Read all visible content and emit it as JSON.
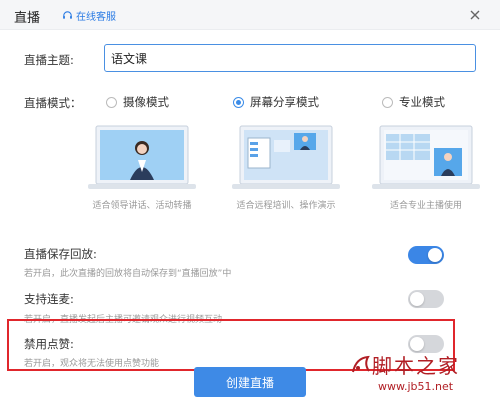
{
  "dialog": {
    "title": "直播",
    "service_label": "在线客服"
  },
  "topic": {
    "label": "直播主题:",
    "value": "语文课"
  },
  "mode": {
    "label": "直播模式：",
    "options": [
      {
        "label": "摄像模式",
        "selected": false,
        "caption": "适合领导讲话、活动转播"
      },
      {
        "label": "屏幕分享模式",
        "selected": true,
        "caption": "适合远程培训、操作演示"
      },
      {
        "label": "专业模式",
        "selected": false,
        "caption": "适合专业主播使用"
      }
    ]
  },
  "settings": [
    {
      "title": "直播保存回放:",
      "desc": "若开启，此次直播的回放将自动保存到“直播回放”中",
      "on": true
    },
    {
      "title": "支持连麦:",
      "desc": "若开启，直播发起后主播可邀请观众进行视频互动",
      "on": false
    },
    {
      "title": "禁用点赞:",
      "desc": "若开启，观众将无法使用点赞功能",
      "on": false
    }
  ],
  "create_button": "创建直播",
  "watermark": {
    "text": "脚本之家",
    "url": "www.jb51.net"
  },
  "colors": {
    "accent": "#3e8ae6",
    "highlight": "#e0262c",
    "watermark": "#b11e24"
  }
}
